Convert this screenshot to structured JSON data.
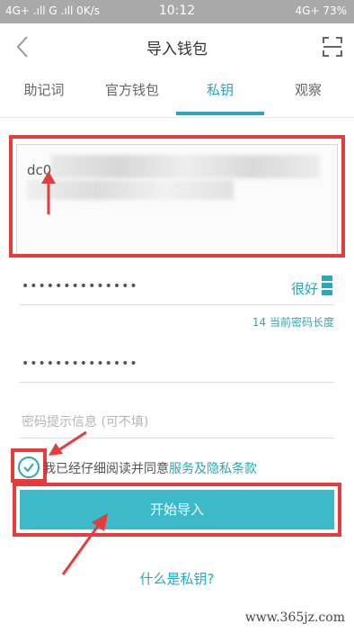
{
  "status_bar": {
    "left": "4G+ .ıll G .ıll 0K/s",
    "time": "10:12",
    "right": "4G+ 73%"
  },
  "header": {
    "title": "导入钱包"
  },
  "tabs": [
    {
      "label": "助记词"
    },
    {
      "label": "官方钱包"
    },
    {
      "label": "私钥"
    },
    {
      "label": "观察"
    }
  ],
  "private_key": {
    "visible_prefix": "dc0"
  },
  "password": {
    "dots": "••••••••••••••",
    "strength_label": "很好",
    "length_hint": "14 当前密码长度"
  },
  "confirm_password": {
    "dots": "••••••••••••••"
  },
  "hint_field": {
    "placeholder": "密码提示信息 (可不填)"
  },
  "agreement": {
    "text": "我已经仔细阅读并同意",
    "link": "服务及隐私条款",
    "checked": true
  },
  "import_button": {
    "label": "开始导入"
  },
  "help_link": {
    "label": "什么是私钥?"
  },
  "watermark": {
    "text": "www.365jz.com"
  },
  "colors": {
    "accent": "#2aa7b8",
    "button": "#3db9c7",
    "annotation_red": "#e83b3b"
  }
}
